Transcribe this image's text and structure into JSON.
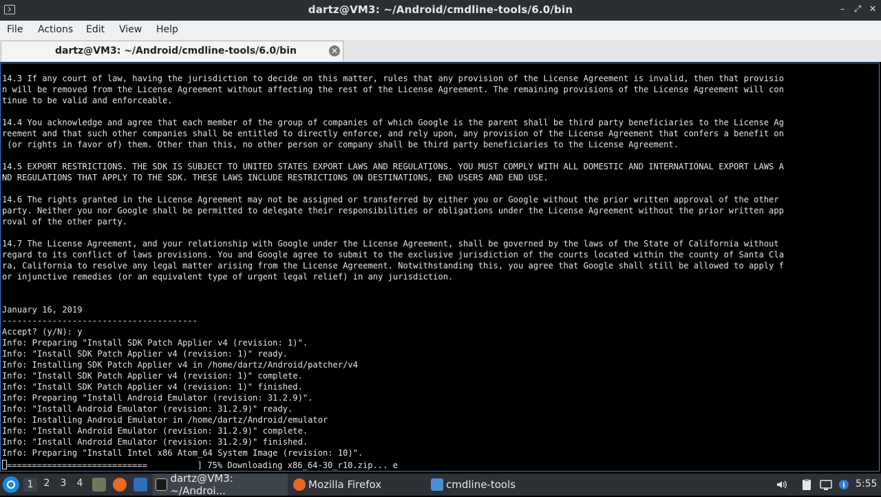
{
  "window": {
    "title": "dartz@VM3: ~/Android/cmdline-tools/6.0/bin",
    "controls": {
      "minimize": "–",
      "maximize": "⤢",
      "close": "✕"
    }
  },
  "menu": {
    "file": "File",
    "actions": "Actions",
    "edit": "Edit",
    "view": "View",
    "help": "Help"
  },
  "tab": {
    "label": "dartz@VM3: ~/Android/cmdline-tools/6.0/bin",
    "close_glyph": "✕"
  },
  "terminal": {
    "lines": [
      "14.3 If any court of law, having the jurisdiction to decide on this matter, rules that any provision of the License Agreement is invalid, then that provisio",
      "n will be removed from the License Agreement without affecting the rest of the License Agreement. The remaining provisions of the License Agreement will con",
      "tinue to be valid and enforceable.",
      "",
      "14.4 You acknowledge and agree that each member of the group of companies of which Google is the parent shall be third party beneficiaries to the License Ag",
      "reement and that such other companies shall be entitled to directly enforce, and rely upon, any provision of the License Agreement that confers a benefit on",
      " (or rights in favor of) them. Other than this, no other person or company shall be third party beneficiaries to the License Agreement.",
      "",
      "14.5 EXPORT RESTRICTIONS. THE SDK IS SUBJECT TO UNITED STATES EXPORT LAWS AND REGULATIONS. YOU MUST COMPLY WITH ALL DOMESTIC AND INTERNATIONAL EXPORT LAWS A",
      "ND REGULATIONS THAT APPLY TO THE SDK. THESE LAWS INCLUDE RESTRICTIONS ON DESTINATIONS, END USERS AND END USE.",
      "",
      "14.6 The rights granted in the License Agreement may not be assigned or transferred by either you or Google without the prior written approval of the other",
      "party. Neither you nor Google shall be permitted to delegate their responsibilities or obligations under the License Agreement without the prior written app",
      "roval of the other party.",
      "",
      "14.7 The License Agreement, and your relationship with Google under the License Agreement, shall be governed by the laws of the State of California without",
      "regard to its conflict of laws provisions. You and Google agree to submit to the exclusive jurisdiction of the courts located within the county of Santa Cla",
      "ra, California to resolve any legal matter arising from the License Agreement. Notwithstanding this, you agree that Google shall still be allowed to apply f",
      "or injunctive remedies (or an equivalent type of urgent legal relief) in any jurisdiction.",
      "",
      "",
      "January 16, 2019",
      "---------------------------------------",
      "Accept? (y/N): y",
      "Info: Preparing \"Install SDK Patch Applier v4 (revision: 1)\".",
      "Info: \"Install SDK Patch Applier v4 (revision: 1)\" ready.",
      "Info: Installing SDK Patch Applier v4 in /home/dartz/Android/patcher/v4",
      "Info: \"Install SDK Patch Applier v4 (revision: 1)\" complete.",
      "Info: \"Install SDK Patch Applier v4 (revision: 1)\" finished.",
      "Info: Preparing \"Install Android Emulator (revision: 31.2.9)\".",
      "Info: \"Install Android Emulator (revision: 31.2.9)\" ready.",
      "Info: Installing Android Emulator in /home/dartz/Android/emulator",
      "Info: \"Install Android Emulator (revision: 31.2.9)\" complete.",
      "Info: \"Install Android Emulator (revision: 31.2.9)\" finished.",
      "Info: Preparing \"Install Intel x86 Atom_64 System Image (revision: 10)\"."
    ],
    "progress_line": "============================          ] 75% Downloading x86_64-30_r10.zip... e",
    "download_progress": 0.75
  },
  "taskbar": {
    "workspaces": [
      "1",
      "2",
      "3",
      "4"
    ],
    "active_workspace": 0,
    "tasks": [
      {
        "label": "dartz@VM3: ~/Androi...",
        "icon": "terminal-icon",
        "active": true
      },
      {
        "label": "Mozilla Firefox",
        "icon": "firefox-icon",
        "active": false
      },
      {
        "label": "cmdline-tools",
        "icon": "folder-icon",
        "active": false
      }
    ],
    "clock": "5:55",
    "colors": {
      "accent": "#1e88d8",
      "bar": "#2d3136"
    }
  }
}
